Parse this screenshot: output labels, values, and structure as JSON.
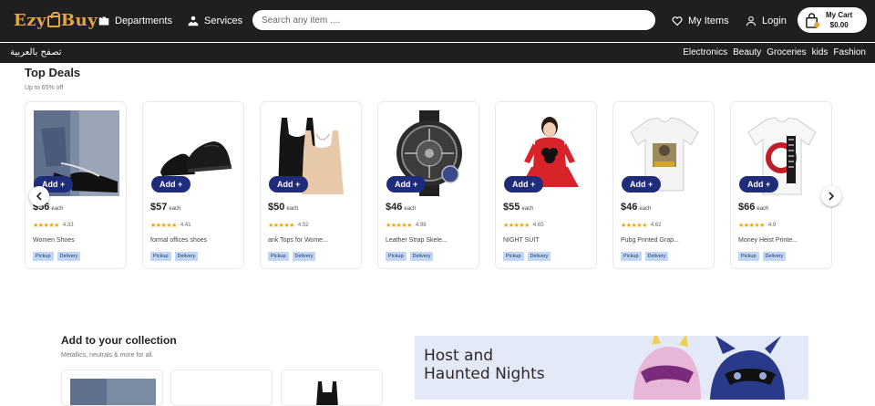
{
  "header": {
    "logo_text_1": "Ezy",
    "logo_text_2": "Buy",
    "departments_label": "Departments",
    "services_label": "Services",
    "search_placeholder": "Search any item ....",
    "my_items_label": "My Items",
    "login_label": "Login",
    "cart_label": "My Cart",
    "cart_total": "$0.00"
  },
  "subnav": {
    "arabic_label": "تصفح بالعربية",
    "categories": [
      "Electronics",
      "Beauty",
      "Groceries",
      "kids",
      "Fashion"
    ]
  },
  "top_deals": {
    "title": "Top Deals",
    "subtitle": "Up to 65% off",
    "add_label": "Add +",
    "each_label": "each",
    "tag_pickup": "Pickup",
    "tag_delivery": "Delivery",
    "products": [
      {
        "price": "$56",
        "rating": "4.33",
        "name": "Women Shoes",
        "image": "sandals-photo"
      },
      {
        "price": "$57",
        "rating": "4.41",
        "name": "formal offices shoes",
        "image": "black-shoes-photo"
      },
      {
        "price": "$50",
        "rating": "4.52",
        "name": "ank Tops for Wome...",
        "image": "tank-tops-photo"
      },
      {
        "price": "$46",
        "rating": "4.98",
        "name": "Leather Strap Skele...",
        "image": "watch-photo"
      },
      {
        "price": "$55",
        "rating": "4.65",
        "name": "NIGHT SUIT",
        "image": "night-suit-photo"
      },
      {
        "price": "$46",
        "rating": "4.62",
        "name": "Pubg Printed Grap...",
        "image": "pubg-tshirt-photo"
      },
      {
        "price": "$66",
        "rating": "4.9",
        "name": "Money Heist Printe...",
        "image": "money-heist-tshirt-photo"
      }
    ]
  },
  "collection": {
    "title": "Add to your collection",
    "subtitle": "Metallics, neutrals & more for all.",
    "banner_title_1": "Host and",
    "banner_title_2": "Haunted Nights"
  },
  "colors": {
    "header_bg": "#1f1f1f",
    "logo": "#e4a640",
    "add_button": "#1f2b7b",
    "tag_bg": "#bfd6f4",
    "star": "#f0a500"
  }
}
